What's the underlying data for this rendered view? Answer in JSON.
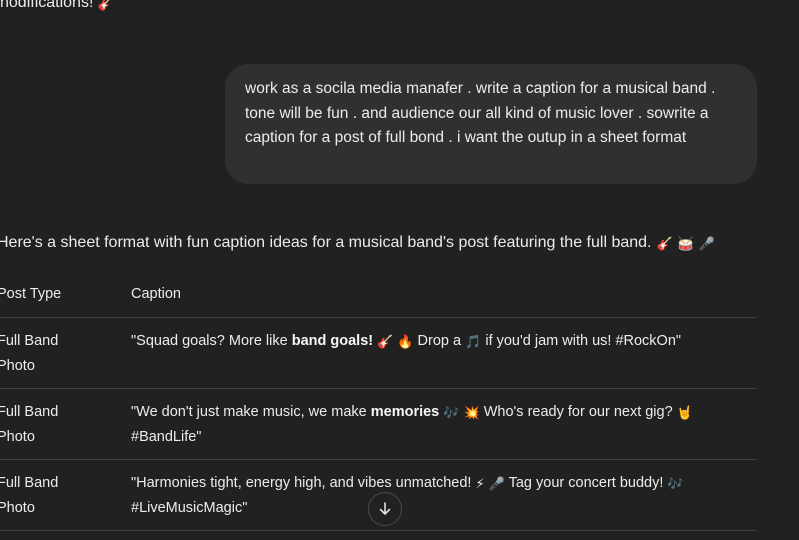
{
  "previous_message": {
    "text": "nodifications! ",
    "emoji": "🎸"
  },
  "user_message": {
    "text": "work as a socila media manafer . write a caption for a musical band . tone will be fun . and audience our all kind of music lover . sowrite a caption for a post of full bond . i want the outup in a sheet format"
  },
  "assistant": {
    "intro": "Here's a sheet format with fun caption ideas for a musical band's post featuring the full band.",
    "intro_emojis": [
      "🎸",
      "🥁",
      "🎤"
    ],
    "table": {
      "headers": {
        "post_type": "Post Type",
        "caption": "Caption"
      },
      "rows": [
        {
          "post_type": "Full Band Photo",
          "caption": {
            "t1": "\"Squad goals? More like ",
            "bold": "band goals!",
            "e1": "🎸",
            "e2": "🔥",
            "t2": " Drop a ",
            "e3": "🎵",
            "t3": " if you'd jam with us! #RockOn\""
          }
        },
        {
          "post_type": "Full Band Photo",
          "caption": {
            "t1": "\"We don't just make music, we make ",
            "bold": "memories",
            "e1": "🎶",
            "e2": "💥",
            "t2": " Who's ready for our next gig? ",
            "e3": "🤘",
            "t3": " #BandLife\""
          }
        },
        {
          "post_type": "Full Band Photo",
          "caption": {
            "t1": "\"Harmonies tight, energy high, and vibes unmatched! ",
            "bold": "",
            "e1": "⚡",
            "e2": "🎤",
            "t2": " Tag your concert buddy! ",
            "e3": "🎶",
            "t3": " #LiveMusicMagic\""
          }
        }
      ]
    }
  },
  "scroll_button": {
    "icon": "arrow-down-icon"
  }
}
